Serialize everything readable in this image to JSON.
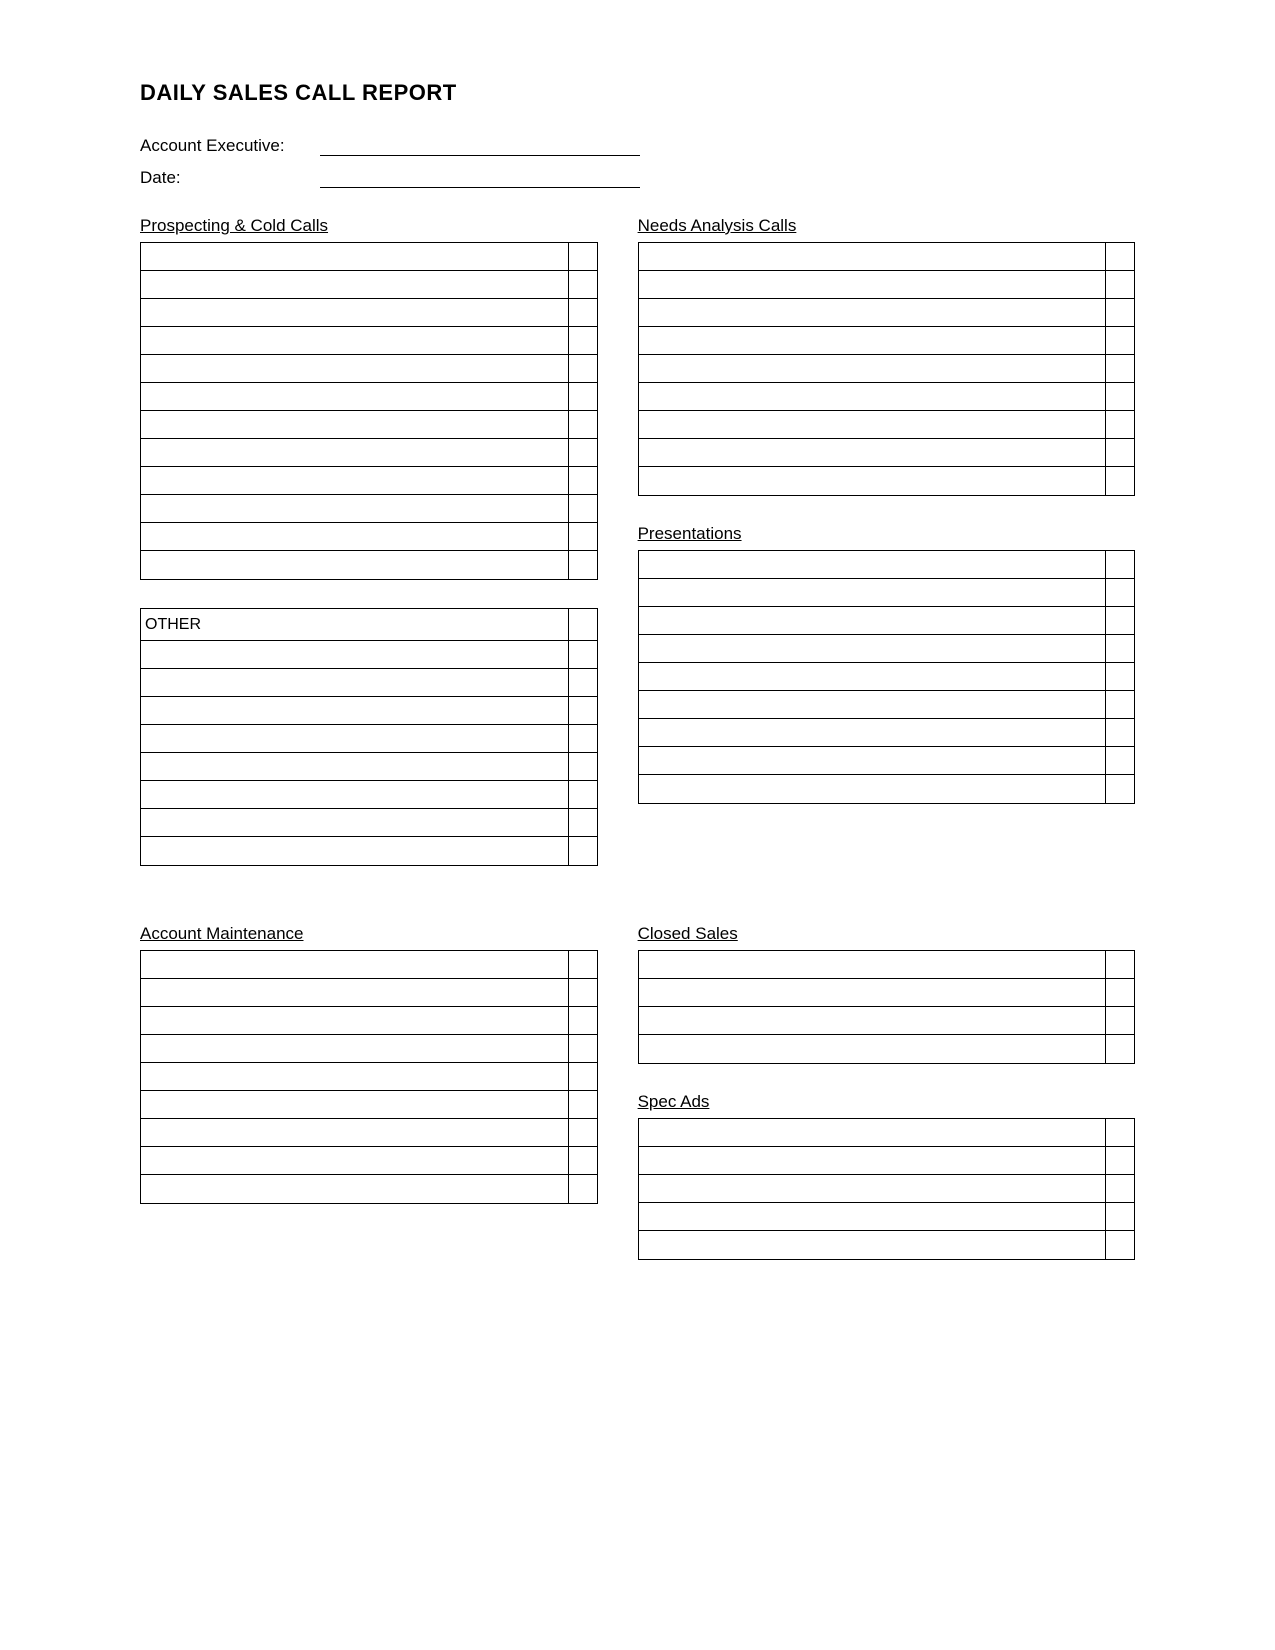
{
  "title": "DAILY SALES CALL REPORT",
  "header": {
    "account_executive_label": "Account Executive:",
    "date_label": "Date:"
  },
  "sections": {
    "prospecting": {
      "title": "Prospecting & Cold Calls",
      "rows": 12
    },
    "other": {
      "title": "OTHER",
      "rows": 8
    },
    "needs_analysis": {
      "title": "Needs Analysis Calls",
      "rows": 9
    },
    "presentations": {
      "title": "Presentations",
      "rows": 9
    },
    "account_maintenance": {
      "title": "Account Maintenance",
      "rows": 9
    },
    "closed_sales": {
      "title": "Closed Sales",
      "rows": 4
    },
    "spec_ads": {
      "title": "Spec Ads",
      "rows": 5
    }
  }
}
